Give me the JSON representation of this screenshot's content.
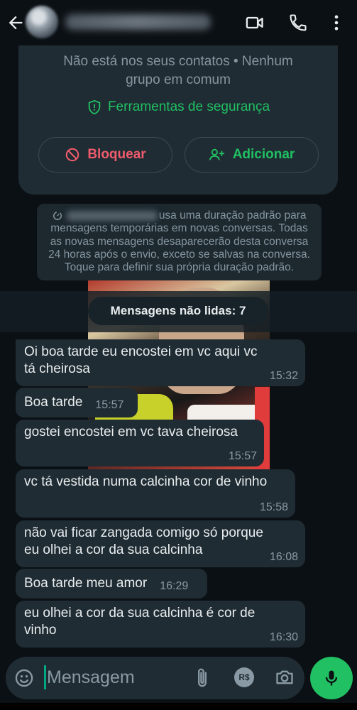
{
  "header": {
    "contact_name": "+55 00 00000-0000",
    "icons": [
      "back-arrow-icon",
      "video-call-icon",
      "phone-icon",
      "more-vertical-icon"
    ]
  },
  "info_card": {
    "not_in_contacts_line1": "Não está nos seus contatos • Nenhum",
    "not_in_contacts_line2": "grupo em comum",
    "safety_tools": "Ferramentas de segurança",
    "block_label": "Bloquear",
    "add_label": "Adicionar",
    "colors": {
      "safety": "#21c063",
      "block": "#f15c6d"
    }
  },
  "notice": {
    "line1_suffix": "usa uma duração padrão para",
    "line2": "mensagens temporárias em novas conversas. Todas",
    "line3": "as novas mensagens desaparecerão desta conversa",
    "line4": "24 horas após o envio, exceto se salvas na conversa.",
    "line5": "Toque para definir sua própria duração padrão."
  },
  "unread_divider": "Mensagens não lidas: 7",
  "messages": [
    {
      "text": "Oi boa tarde eu encostei em vc aqui vc tá cheirosa",
      "time": "15:32"
    },
    {
      "text": "Boa tarde",
      "time": "15:57"
    },
    {
      "text": "gostei encostei em vc tava cheirosa",
      "time": "15:57"
    },
    {
      "text": "vc tá vestida numa calcinha cor de vinho",
      "time": "15:58"
    },
    {
      "text": "não vai ficar zangada comigo só porque eu olhei a cor da sua calcinha",
      "time": "16:08"
    },
    {
      "text": "Boa tarde meu amor",
      "time": "16:29"
    },
    {
      "text": "eu olhei a cor da sua calcinha é cor de vinho",
      "time": "16:30"
    }
  ],
  "composer": {
    "placeholder": "Mensagem",
    "pay_label": "R$",
    "accent": "#21c063"
  }
}
